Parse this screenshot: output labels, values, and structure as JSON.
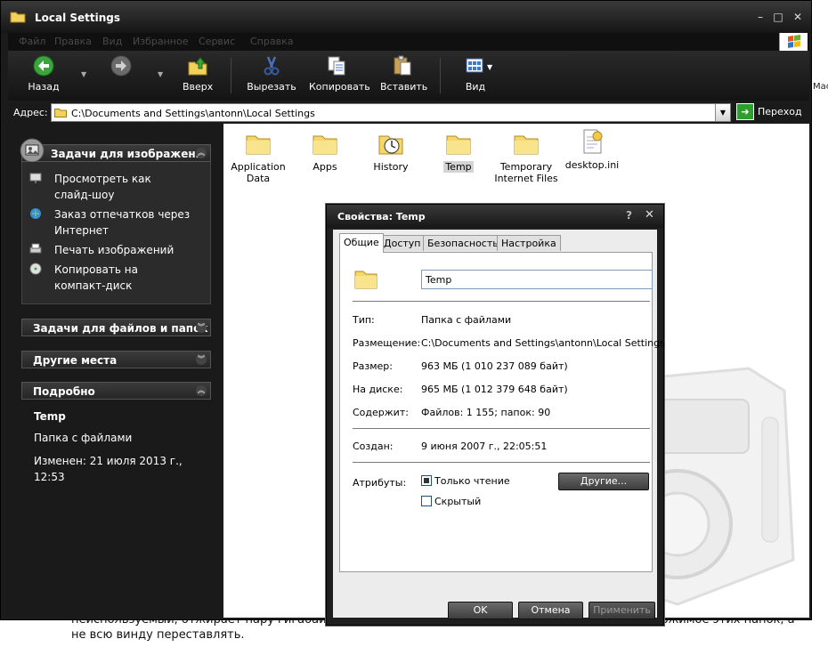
{
  "background_page": {
    "text": "неиспользуемый, отжирает пару гигабайт. Но конечно достаточно периодически удалять содержимое этих папок, а не всю винду переставлять.",
    "edge_right": "Масс"
  },
  "window": {
    "title": "Local Settings"
  },
  "menu": [
    "Файл",
    "Правка",
    "Вид",
    "Избранное",
    "Сервис",
    "Справка"
  ],
  "toolbar": {
    "back": "Назад",
    "up": "Вверх",
    "cut": "Вырезать",
    "copy": "Копировать",
    "paste": "Вставить",
    "view": "Вид"
  },
  "address": {
    "label": "Адрес:",
    "value": "C:\\Documents and Settings\\antonn\\Local Settings",
    "go": "Переход"
  },
  "taskpane": {
    "image_tasks": {
      "title": "Задачи для изображени",
      "items": [
        {
          "label": "Просмотреть как слайд-шоу",
          "icon": "slideshow-icon"
        },
        {
          "label": "Заказ отпечатков через Интернет",
          "icon": "order-prints-icon"
        },
        {
          "label": "Печать изображений",
          "icon": "printer-icon"
        },
        {
          "label": "Копировать на компакт-диск",
          "icon": "cd-icon"
        }
      ]
    },
    "file_tasks": "Задачи для файлов и папок",
    "other_places": "Другие места",
    "details": {
      "title": "Подробно",
      "name": "Temp",
      "type": "Папка с файлами",
      "modified": "Изменен: 21 июля 2013 г., 12:53"
    }
  },
  "files": [
    {
      "label": "Application Data",
      "icon": "folder-icon"
    },
    {
      "label": "Apps",
      "icon": "folder-icon"
    },
    {
      "label": "History",
      "icon": "history-folder-icon"
    },
    {
      "label": "Temp",
      "icon": "folder-icon",
      "selected": true
    },
    {
      "label": "Temporary Internet Files",
      "icon": "folder-icon"
    },
    {
      "label": "desktop.ini",
      "icon": "ini-file-icon"
    }
  ],
  "dialog": {
    "title": "Свойства: Temp",
    "tabs": [
      "Общие",
      "Доступ",
      "Безопасность",
      "Настройка"
    ],
    "name": "Temp",
    "props": {
      "type_label": "Тип:",
      "type_value": "Папка с файлами",
      "location_label": "Размещение:",
      "location_value": "C:\\Documents and Settings\\antonn\\Local Settings",
      "size_label": "Размер:",
      "size_value": "963 МБ (1 010 237 089 байт)",
      "disk_label": "На диске:",
      "disk_value": "965 МБ (1 012 379 648 байт)",
      "contains_label": "Содержит:",
      "contains_value": "Файлов: 1 155; папок: 90",
      "created_label": "Создан:",
      "created_value": "9 июня 2007 г., 22:05:51",
      "attributes_label": "Атрибуты:"
    },
    "readonly": "Только чтение",
    "hidden": "Скрытый",
    "other_button": "Другие...",
    "ok": "OK",
    "cancel": "Отмена",
    "apply": "Применить"
  }
}
